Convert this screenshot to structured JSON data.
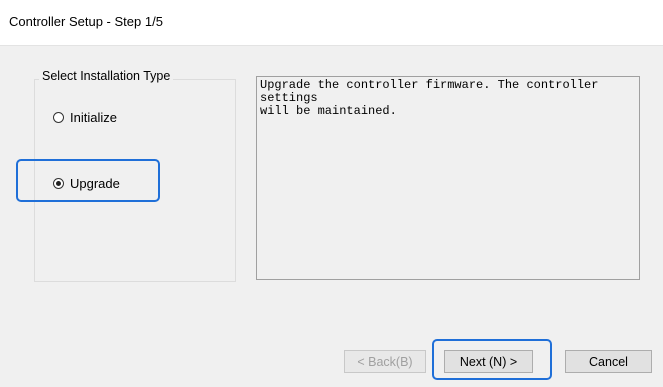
{
  "window": {
    "title": "Controller Setup - Step 1/5"
  },
  "install_type": {
    "legend": "Select Installation Type",
    "options": [
      {
        "label": "Initialize",
        "selected": false
      },
      {
        "label": "Upgrade",
        "selected": true
      }
    ]
  },
  "description": {
    "text": "Upgrade the controller firmware. The controller settings\nwill be maintained."
  },
  "buttons": {
    "back_label": "< Back(B)",
    "next_label": "Next (N) >",
    "cancel_label": "Cancel"
  },
  "colors": {
    "highlight": "#1f6fd8",
    "dialog_bg": "#f0f0f0"
  }
}
